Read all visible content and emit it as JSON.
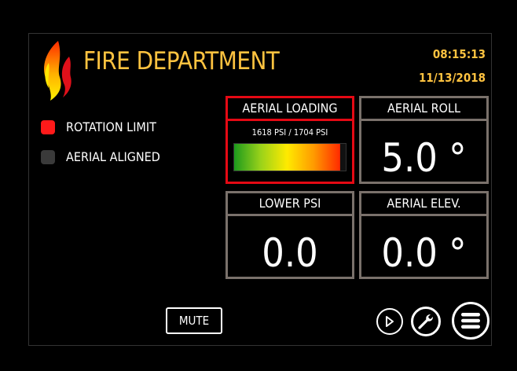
{
  "header": {
    "title": "FIRE DEPARTMENT",
    "time": "08:15:13",
    "date": "11/13/2018",
    "logo_icon": "flame-icon"
  },
  "indicators": [
    {
      "label": "ROTATION LIMIT",
      "active": true,
      "color": "#ff1a1a"
    },
    {
      "label": "AERIAL ALIGNED",
      "active": false,
      "color": "#3a3a3a"
    }
  ],
  "cards": {
    "aerial_loading": {
      "title": "AERIAL LOADING",
      "current_psi": "1618 PSI",
      "separator": "/",
      "max_psi": "1704 PSI",
      "load_fraction": 0.95,
      "alert": true
    },
    "aerial_roll": {
      "title": "AERIAL ROLL",
      "value": "5.0 °"
    },
    "lower_psi": {
      "title": "LOWER PSI",
      "value": "0.0"
    },
    "aerial_elev": {
      "title": "AERIAL ELEV.",
      "value": "0.0 °"
    }
  },
  "controls": {
    "mute_label": "MUTE",
    "play_icon": "play-icon",
    "wrench_icon": "wrench-icon",
    "menu_icon": "menu-icon"
  },
  "colors": {
    "accent_gold": "#ffc340",
    "alert_red": "#e50914",
    "card_border": "#7a716b"
  }
}
